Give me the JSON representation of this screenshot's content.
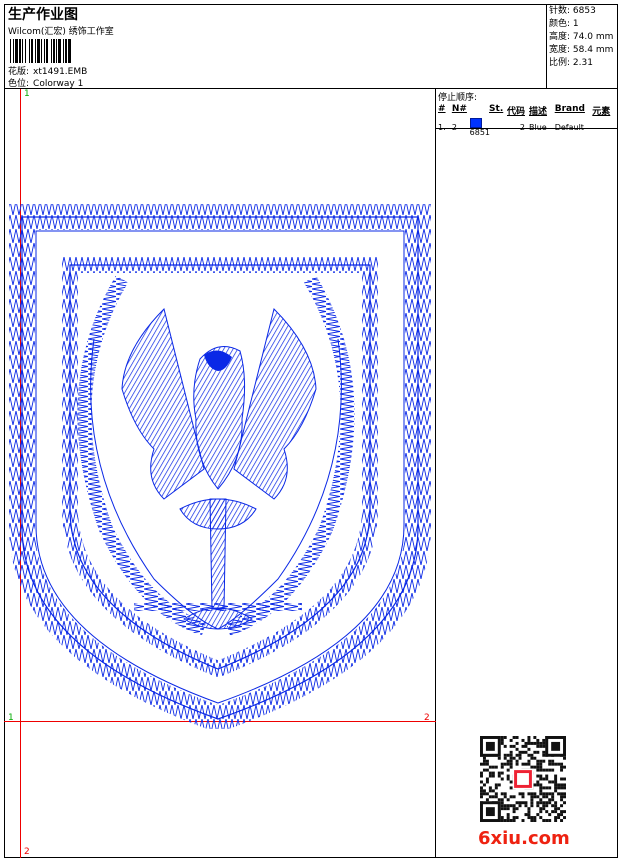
{
  "header": {
    "title": "生产作业图",
    "subtitle": "Wilcom(汇宏) 绣饰工作室",
    "design_label": "花版:",
    "design_value": "xt1491.EMB",
    "colorway_label": "色位:",
    "colorway_value": "Colorway 1"
  },
  "specs": [
    {
      "label": "针数:",
      "value": "6853"
    },
    {
      "label": "颜色:",
      "value": "1"
    },
    {
      "label": "高度:",
      "value": "74.0 mm"
    },
    {
      "label": "宽度:",
      "value": "58.4 mm"
    },
    {
      "label": "比例:",
      "value": "2.31"
    }
  ],
  "canvas": {
    "marker_top_left": "1",
    "marker_mid_left": "1",
    "marker_mid_right": "2",
    "marker_bottom_left": "2"
  },
  "stop_sequence": {
    "title": "停止顺序:",
    "columns": [
      "#",
      "N#",
      "St.",
      "代码",
      "描述",
      "Brand",
      "元素"
    ],
    "rows": [
      {
        "idx": "1.",
        "n": "2",
        "st": "6851",
        "code": "2",
        "desc": "Blue",
        "brand": "Default",
        "element": ""
      }
    ]
  },
  "colors": {
    "thread": "#0a28e6",
    "guide_line": "#e00000",
    "marker_green": "#00aa00"
  },
  "watermark": {
    "logo": "6xiu.com"
  }
}
